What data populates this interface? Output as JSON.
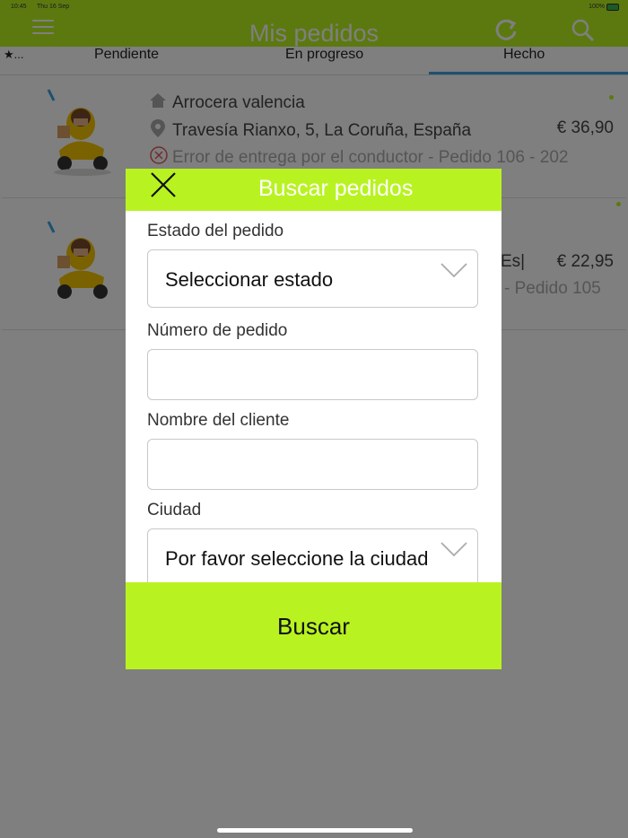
{
  "status_bar": {
    "time": "10:45",
    "date": "Thu 16 Sep",
    "battery": "100%"
  },
  "navbar": {
    "title": "Mis pedidos",
    "menu_icon": "hamburger-icon",
    "refresh_icon": "refresh-icon",
    "search_icon": "search-icon"
  },
  "tabs": [
    {
      "label": "★..."
    },
    {
      "label": "Pendiente"
    },
    {
      "label": "En progreso"
    },
    {
      "label": "Hecho",
      "selected": true
    }
  ],
  "orders": [
    {
      "name": "Arrocera valencia",
      "address": "Travesía Rianxo, 5, La Coruña, España",
      "price": "€ 36,90",
      "status": "Error de entrega por el conductor - Pedido 106 - 202"
    },
    {
      "address_fragment": "Es|",
      "price": "€ 22,95",
      "status_fragment": "- Pedido 105"
    }
  ],
  "dialog": {
    "title": "Buscar pedidos",
    "fields": {
      "estado": {
        "label": "Estado del pedido",
        "value": "Seleccionar estado"
      },
      "numero": {
        "label": "Número de pedido",
        "value": ""
      },
      "cliente": {
        "label": "Nombre del cliente",
        "value": ""
      },
      "ciudad": {
        "label": "Ciudad",
        "value": "Por favor seleccione la ciudad"
      }
    },
    "button": "Buscar"
  },
  "colors": {
    "brand": "#b8f321",
    "tab_indicator": "#3aa0e0",
    "error": "#e05a5a"
  }
}
